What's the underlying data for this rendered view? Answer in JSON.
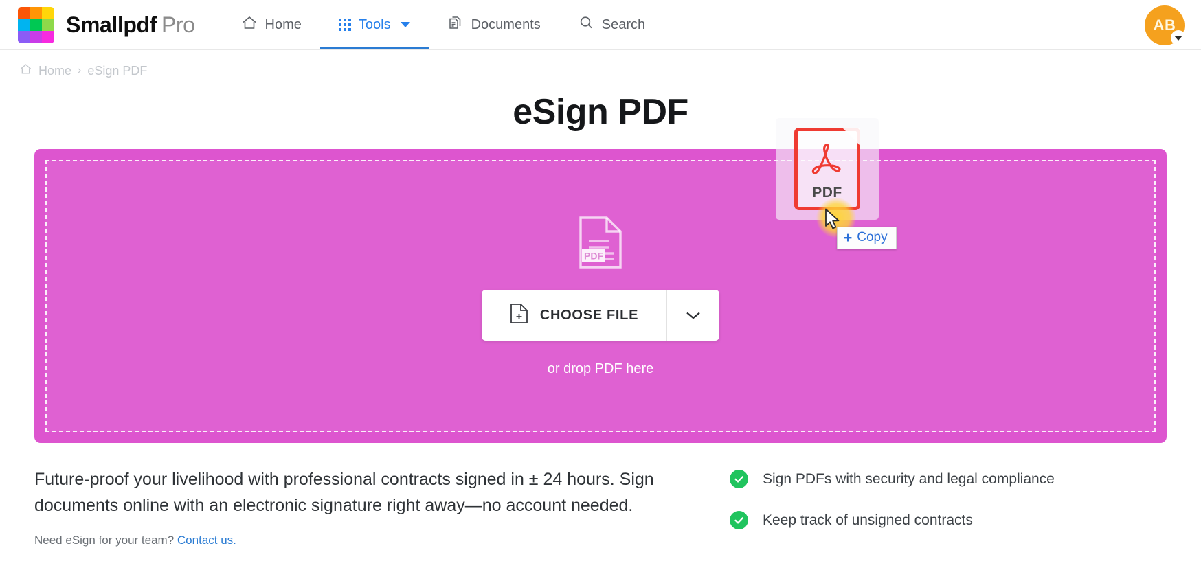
{
  "nav": {
    "brand_bold": "Smallpdf",
    "brand_light": "Pro",
    "logo_colors": [
      "#fb5607",
      "#ff9505",
      "#ffd60a",
      "#00b4f0",
      "#00c853",
      "#8ed94a",
      "#8b5cf6",
      "#c93ce8",
      "#f72ae0"
    ],
    "items": [
      {
        "label": "Home",
        "icon": "home-icon",
        "active": false
      },
      {
        "label": "Tools",
        "icon": "grid-dots-icon",
        "active": true,
        "has_caret": true
      },
      {
        "label": "Documents",
        "icon": "documents-icon",
        "active": false
      },
      {
        "label": "Search",
        "icon": "search-icon",
        "active": false
      }
    ],
    "avatar_initials": "AB",
    "accent_blue": "#2680eb"
  },
  "breadcrumb": {
    "home": "Home",
    "separator": "›",
    "current": "eSign PDF"
  },
  "page": {
    "title": "eSign PDF"
  },
  "dropzone": {
    "background_color": "#dd55cf",
    "choose_file_label": "CHOOSE FILE",
    "drop_hint": "or drop PDF here",
    "placeholder_icon": "pdf-document-icon",
    "placeholder_label": "PDF"
  },
  "drag": {
    "file_type_label": "PDF",
    "tooltip_label": "Copy",
    "tooltip_plus": "+"
  },
  "description": {
    "paragraph": "Future-proof your livelihood with professional contracts signed in ± 24 hours. Sign documents online with an electronic signature right away—no account needed.",
    "team_prompt": "Need eSign for your team?",
    "team_link": "Contact us."
  },
  "features": [
    {
      "text": "Sign PDFs with security and legal compliance"
    },
    {
      "text": "Keep track of unsigned contracts"
    }
  ]
}
